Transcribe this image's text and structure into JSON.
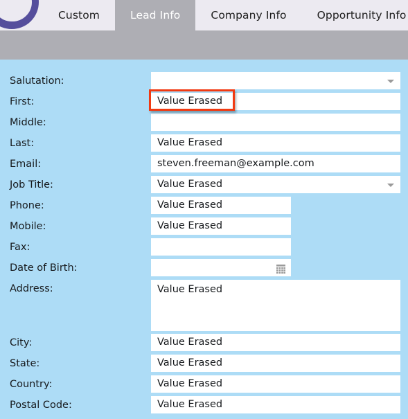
{
  "theme": {
    "tabstrip_bg": "#eceaf1",
    "active_tab_bg": "#aeaeb4",
    "active_tab_text": "#ffffff",
    "band_bg": "#aeaeb4",
    "form_bg": "#addcf6",
    "field_bg": "#ffffff",
    "text": "#16191c",
    "logo_purple": "#554e9c",
    "highlight_red": "#f13a12"
  },
  "logo": {
    "icon": "circular-arc-logo"
  },
  "tabs": [
    {
      "label": "Custom",
      "active": false
    },
    {
      "label": "Lead Info",
      "active": true
    },
    {
      "label": "Company Info",
      "active": false
    },
    {
      "label": "Opportunity Info",
      "active": false
    }
  ],
  "form": {
    "highlighted_field": "First",
    "fields": [
      {
        "label": "Salutation:",
        "value": "",
        "control": "select",
        "width": "wide",
        "icon": "chevron-down-icon"
      },
      {
        "label": "First:",
        "value": "Value Erased",
        "control": "text",
        "width": "wide",
        "highlighted": true
      },
      {
        "label": "Middle:",
        "value": "",
        "control": "text",
        "width": "wide"
      },
      {
        "label": "Last:",
        "value": "Value Erased",
        "control": "text",
        "width": "wide"
      },
      {
        "label": "Email:",
        "value": "steven.freeman@example.com",
        "control": "text",
        "width": "wide"
      },
      {
        "label": "Job Title:",
        "value": "Value Erased",
        "control": "select",
        "width": "wide",
        "icon": "chevron-down-icon"
      },
      {
        "label": "Phone:",
        "value": "Value Erased",
        "control": "text",
        "width": "narrow"
      },
      {
        "label": "Mobile:",
        "value": "Value Erased",
        "control": "text",
        "width": "narrow"
      },
      {
        "label": "Fax:",
        "value": "",
        "control": "text",
        "width": "narrow"
      },
      {
        "label": "Date of Birth:",
        "value": "",
        "control": "date",
        "width": "narrow",
        "icon": "calendar-icon"
      },
      {
        "label": "Address:",
        "value": "Value Erased",
        "control": "textarea",
        "width": "wide"
      },
      {
        "label": "City:",
        "value": "Value Erased",
        "control": "text",
        "width": "wide"
      },
      {
        "label": "State:",
        "value": "Value Erased",
        "control": "text",
        "width": "wide"
      },
      {
        "label": "Country:",
        "value": "Value Erased",
        "control": "text",
        "width": "wide"
      },
      {
        "label": "Postal Code:",
        "value": "Value Erased",
        "control": "text",
        "width": "wide"
      }
    ]
  }
}
